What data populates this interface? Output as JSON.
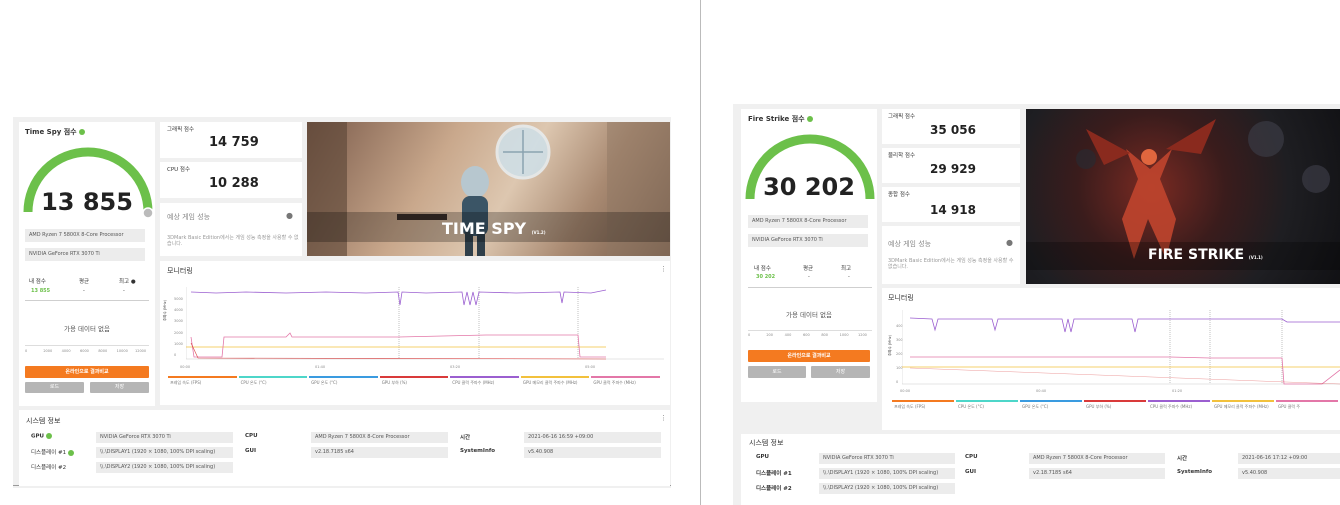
{
  "left": {
    "title": "Time Spy 점수",
    "score": "13 855",
    "processor": "AMD Ryzen 7 5800X 8-Core Processor",
    "gpu": "NVIDIA GeForce RTX 3070 Ti",
    "my_score_label": "내 점수",
    "avg_label": "평균",
    "best_label": "최고",
    "my_score_value": "13 855",
    "avg_value": "-",
    "best_value": "-",
    "no_data": "가용 데이터 없음",
    "compare_button": "온라인으로 결과비교",
    "btn_a": "로드",
    "btn_b": "저장",
    "stat1_label": "그래픽 점수",
    "stat1_value": "14 759",
    "stat2_label": "CPU 점수",
    "stat2_value": "10 288",
    "est_title": "예상 게임 성능",
    "est_desc": "3DMark Basic Edition에서는 게임 성능 측정을 사용할 수 없습니다.",
    "hero_title": "TIME SPY",
    "hero_version": "(V1.2)",
    "monitor_title": "모니터링",
    "sys_title": "시스템 정보",
    "hist_ticks": [
      "0",
      "2000",
      "4000",
      "6000",
      "8000",
      "10000",
      "12000"
    ],
    "chart_x_ticks": [
      "00:00",
      "01:40",
      "03:20",
      "05:00"
    ],
    "chart_y_ticks": [
      "0",
      "1000",
      "2000",
      "3000",
      "4000",
      "5000"
    ],
    "chart_y_label": "주파수 (MHz)",
    "legend": [
      "프레임 속도 (FPS)",
      "CPU 온도 (°C)",
      "GPU 온도 (°C)",
      "GPU 부하 (%)",
      "CPU 클럭 주파수 (MHz)",
      "GPU 메모리 클럭 주파수 (MHz)",
      "GPU 클럭 주파수 (MHz)"
    ],
    "sys": {
      "gpu_label": "GPU",
      "gpu_value": "NVIDIA GeForce RTX 3070 Ti",
      "d1_label": "디스플레이 #1",
      "d1_value": "\\\\.\\DISPLAY1 (1920 × 1080, 100% DPI scaling)",
      "d2_label": "디스플레이 #2",
      "d2_value": "\\\\.\\DISPLAY2 (1920 × 1080, 100% DPI scaling)",
      "cpu_label": "CPU",
      "cpu_value": "AMD Ryzen 7 5800X 8-Core Processor",
      "gui_label": "GUI",
      "gui_value": "v2.18.7185 s64",
      "time_label": "시간",
      "time_value": "2021-06-16 16:59 +09:00",
      "si_label": "SystemInfo",
      "si_value": "v5.40.908"
    }
  },
  "right": {
    "title": "Fire Strike 점수",
    "score": "30 202",
    "processor": "AMD Ryzen 7 5800X 8-Core Processor",
    "gpu": "NVIDIA GeForce RTX 3070 Ti",
    "my_score_label": "내 점수",
    "avg_label": "평균",
    "best_label": "최고",
    "my_score_value": "30 202",
    "avg_value": "-",
    "best_value": "-",
    "no_data": "가용 데이터 없음",
    "compare_button": "온라인으로 결과비교",
    "btn_a": "로드",
    "btn_b": "저장",
    "stat1_label": "그래픽 점수",
    "stat1_value": "35 056",
    "stat2_label": "물리학 점수",
    "stat2_value": "29 929",
    "stat3_label": "종합 점수",
    "stat3_value": "14 918",
    "est_title": "예상 게임 성능",
    "est_desc": "3DMark Basic Edition에서는 게임 성능 측정을 사용할 수 없습니다.",
    "hero_title": "FIRE STRIKE",
    "hero_version": "(V1.1)",
    "monitor_title": "모니터링",
    "sys_title": "시스템 정보",
    "hist_ticks": [
      "0",
      "200",
      "400",
      "600",
      "800",
      "1000",
      "1200"
    ],
    "chart_x_ticks": [
      "00:00",
      "00:40",
      "01:20"
    ],
    "chart_y_ticks": [
      "0",
      "100",
      "200",
      "300",
      "400"
    ],
    "chart_y_label": "주파수 (MHz)",
    "legend": [
      "프레임 속도 (FPS)",
      "CPU 온도 (°C)",
      "GPU 온도 (°C)",
      "GPU 부하 (%)",
      "CPU 클럭 주파수 (MHz)",
      "GPU 메모리 클럭 주파수 (MHz)",
      "GPU 클럭 주"
    ],
    "sys": {
      "gpu_label": "GPU",
      "gpu_value": "NVIDIA GeForce RTX 3070 Ti",
      "d1_label": "디스플레이 #1",
      "d1_value": "\\\\.\\DISPLAY1 (1920 × 1080, 100% DPI scaling)",
      "d2_label": "디스플레이 #2",
      "d2_value": "\\\\.\\DISPLAY2 (1920 × 1080, 100% DPI scaling)",
      "cpu_label": "CPU",
      "cpu_value": "AMD Ryzen 7 5800X 8-Core Processor",
      "gui_label": "GUI",
      "gui_value": "v2.18.7185 s64",
      "time_label": "시간",
      "time_value": "2021-06-16 17:12 +09:00",
      "si_label": "SystemInfo",
      "si_value": "v5.40.908"
    }
  },
  "colors": {
    "accent_green": "#6cc04a",
    "orange": "#f47a20",
    "purple": "#9b5fd0",
    "pink": "#e377a8",
    "red": "#d93a3a",
    "yellow": "#f2c13c",
    "cyan": "#4dd6c9",
    "blue": "#3a9be0"
  }
}
